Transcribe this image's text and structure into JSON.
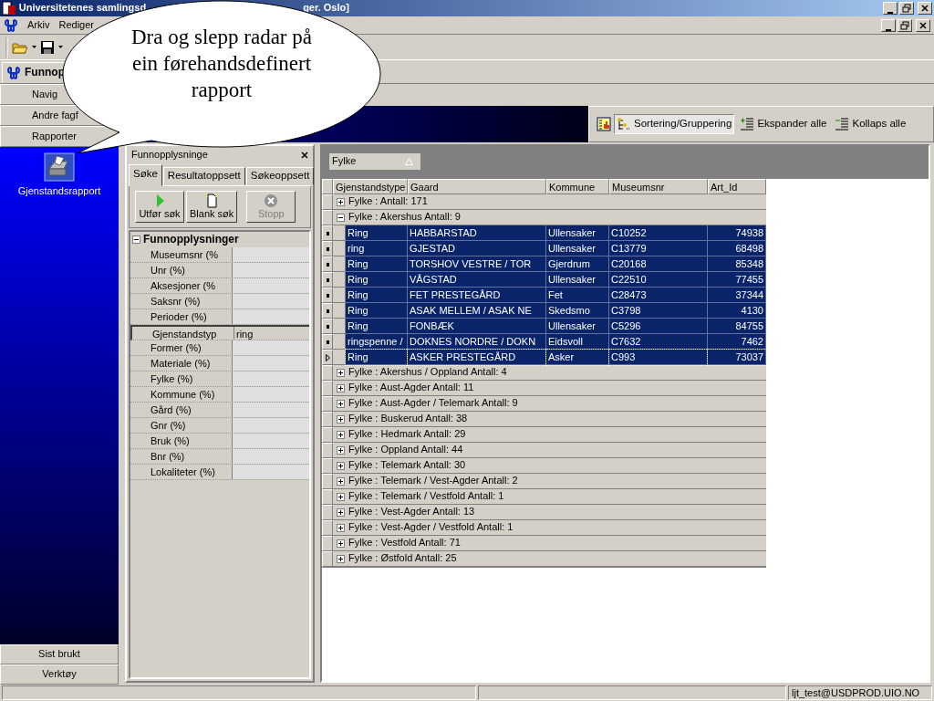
{
  "title_bar": {
    "title_start": "Universitetenes samlingsd",
    "title_end": "ger. Oslo]"
  },
  "menu": [
    "Arkiv",
    "Rediger"
  ],
  "document_tab": {
    "label": "Funnop",
    "selected": true
  },
  "nav_buttons": [
    "Navig",
    "Andre fagf",
    "Rapporter"
  ],
  "reports": [
    {
      "label": "Gjenstandsrapport"
    }
  ],
  "nav_bottom": [
    "Sist brukt",
    "Verktøy"
  ],
  "callout": "Dra og slepp radar på ein førehandsdefinert rapport",
  "search_panel": {
    "title": "Funnopplysninge",
    "tabs": [
      {
        "label": "Søke",
        "selected": true
      },
      {
        "label": "Resultatoppsett",
        "selected": false
      },
      {
        "label": "Søkeoppsett",
        "selected": false
      }
    ],
    "buttons": [
      {
        "label": "Utfør søk",
        "kind": "run",
        "disabled": false
      },
      {
        "label": "Blank søk",
        "kind": "blank",
        "disabled": false
      },
      {
        "label": "Stopp",
        "kind": "stop",
        "disabled": true
      }
    ],
    "section": {
      "label": "Funnopplysninger",
      "expanded": true
    },
    "fields": [
      {
        "label": "Museumsnr (%",
        "selected": false
      },
      {
        "label": "Unr (%)",
        "selected": false
      },
      {
        "label": "Aksesjoner (%",
        "selected": false
      },
      {
        "label": "Saksnr (%)",
        "selected": false
      },
      {
        "label": "Perioder (%)",
        "selected": false
      },
      {
        "label": "Gjenstandstyp",
        "value": "ring",
        "selected": true
      },
      {
        "label": "Former (%)",
        "selected": false
      },
      {
        "label": "Materiale (%)",
        "selected": false
      },
      {
        "label": "Fylke (%)",
        "selected": false
      },
      {
        "label": "Kommune (%)",
        "selected": false
      },
      {
        "label": "Gård (%)",
        "selected": false
      },
      {
        "label": "Gnr (%)",
        "selected": false
      },
      {
        "label": "Bruk (%)",
        "selected": false
      },
      {
        "label": "Bnr (%)",
        "selected": false
      },
      {
        "label": "Lokaliteter (%)",
        "selected": false
      }
    ]
  },
  "grid_toolbar": [
    {
      "label": "Sortering/Gruppering",
      "kind": "sort",
      "pressed": true
    },
    {
      "label": "Ekspander alle",
      "kind": "expand",
      "pressed": false
    },
    {
      "label": "Kollaps alle",
      "kind": "collapse",
      "pressed": false
    }
  ],
  "group_by": {
    "label": "Fylke"
  },
  "table": {
    "columns": [
      "Gjenstandstype",
      "Gaard",
      "Kommune",
      "Museumsnr",
      "Art_Id"
    ],
    "groups": [
      {
        "label": "Fylke :  Antall: 171",
        "expanded": false
      },
      {
        "label": "Fylke : Akershus  Antall: 9",
        "expanded": true,
        "rows": [
          {
            "cells": [
              "Ring",
              "HABBARSTAD",
              "Ullensaker",
              "C10252",
              "74938"
            ],
            "selected": true,
            "current": false
          },
          {
            "cells": [
              "ring",
              "GJESTAD",
              "Ullensaker",
              "C13779",
              "68498"
            ],
            "selected": true,
            "current": false
          },
          {
            "cells": [
              "Ring",
              "TORSHOV VESTRE / TOR",
              "Gjerdrum",
              "C20168",
              "85348"
            ],
            "selected": true,
            "current": false
          },
          {
            "cells": [
              "Ring",
              "VÅGSTAD",
              "Ullensaker",
              "C22510",
              "77455"
            ],
            "selected": true,
            "current": false
          },
          {
            "cells": [
              "Ring",
              "FET PRESTEGÅRD",
              "Fet",
              "C28473",
              "37344"
            ],
            "selected": true,
            "current": false
          },
          {
            "cells": [
              "Ring",
              "ASAK MELLEM / ASAK NE",
              "Skedsmo",
              "C3798",
              "4130"
            ],
            "selected": true,
            "current": false
          },
          {
            "cells": [
              "Ring",
              "FONBÆK",
              "Ullensaker",
              "C5296",
              "84755"
            ],
            "selected": true,
            "current": false
          },
          {
            "cells": [
              "ringspenne /",
              "DOKNES NORDRE / DOKN",
              "Eidsvoll",
              "C7632",
              "7462"
            ],
            "selected": true,
            "current": false
          },
          {
            "cells": [
              "Ring",
              "ASKER PRESTEGÅRD",
              "Asker",
              "C993",
              "73037"
            ],
            "selected": true,
            "current": true
          }
        ]
      },
      {
        "label": "Fylke : Akershus / Oppland  Antall: 4",
        "expanded": false
      },
      {
        "label": "Fylke : Aust-Agder  Antall: 11",
        "expanded": false
      },
      {
        "label": "Fylke : Aust-Agder / Telemark  Antall: 9",
        "expanded": false
      },
      {
        "label": "Fylke : Buskerud  Antall: 38",
        "expanded": false
      },
      {
        "label": "Fylke : Hedmark  Antall: 29",
        "expanded": false
      },
      {
        "label": "Fylke : Oppland  Antall: 44",
        "expanded": false
      },
      {
        "label": "Fylke : Telemark  Antall: 30",
        "expanded": false
      },
      {
        "label": "Fylke : Telemark / Vest-Agder  Antall: 2",
        "expanded": false
      },
      {
        "label": "Fylke : Telemark / Vestfold  Antall: 1",
        "expanded": false
      },
      {
        "label": "Fylke : Vest-Agder  Antall: 13",
        "expanded": false
      },
      {
        "label": "Fylke : Vest-Agder / Vestfold  Antall: 1",
        "expanded": false
      },
      {
        "label": "Fylke : Vestfold  Antall: 71",
        "expanded": false
      },
      {
        "label": "Fylke : Østfold  Antall: 25",
        "expanded": false
      }
    ]
  },
  "status_bar": {
    "user": "ljt_test@USDPROD.UIO.NO"
  }
}
